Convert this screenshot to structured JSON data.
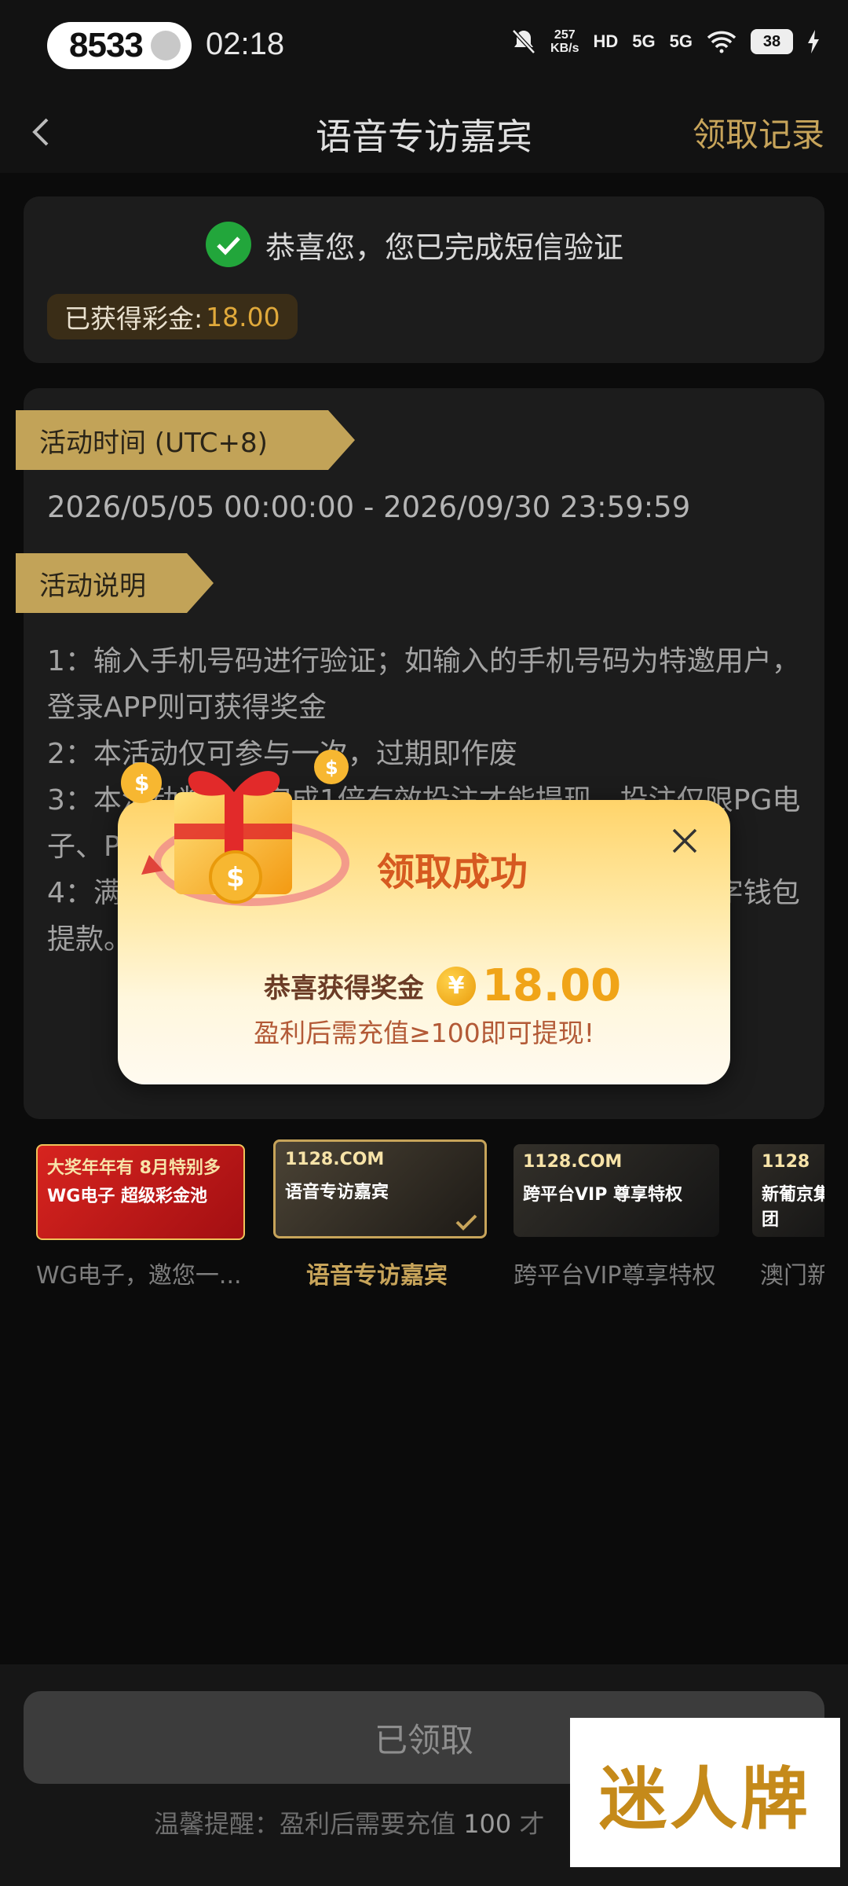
{
  "status_bar": {
    "pill_number": "8533",
    "time": "02:18",
    "net_speed": "257",
    "net_unit": "KB/s",
    "hd_label": "HD",
    "signal1": "5G",
    "signal2": "5G",
    "battery": "38"
  },
  "header": {
    "title": "语音专访嘉宾",
    "records_link": "领取记录"
  },
  "verification": {
    "message": "恭喜您，您已完成短信验证",
    "bonus_label": "已获得彩金:",
    "bonus_amount": "18.00"
  },
  "activity": {
    "time_tag": "活动时间 (UTC+8)",
    "time_range": "2026/05/05 00:00:00 - 2026/09/30 23:59:59",
    "desc_tag": "活动说明",
    "rules": [
      "1：输入手机号码进行验证；如输入的手机号码为特邀用户，登录APP则可获得奖金",
      "2：本活动仅可参与一次，过期即作废",
      "3：本活动奖金需完成1倍有效投注才能提现，投注仅限PG电子、PG电子",
      "4：满足以上条件后，提款额度达到要求，建议使用数字钱包提款。"
    ]
  },
  "banners": [
    {
      "title": "大奖年年有 8月特别多",
      "sub": "WG电子 超级彩金池",
      "label": "WG电子，邀您一..."
    },
    {
      "title": "1128.COM",
      "sub": "语音专访嘉宾",
      "label": "语音专访嘉宾"
    },
    {
      "title": "1128.COM",
      "sub": "跨平台VIP 尊享特权",
      "label": "跨平台VIP尊享特权"
    },
    {
      "title": "1128",
      "sub": "新葡京集团",
      "label": "澳门新"
    }
  ],
  "bottom": {
    "claimed_button": "已领取",
    "reminder_prefix": "温馨提醒：盈利后需要充值",
    "reminder_amount": "100",
    "reminder_suffix": "才"
  },
  "watermark": "迷人牌",
  "popup": {
    "title": "领取成功",
    "prize_label": "恭喜获得奖金",
    "coin_symbol": "¥",
    "prize_amount": "18.00",
    "hint": "盈利后需充值≥100即可提现!"
  },
  "colors": {
    "accent_gold": "#c7a45a",
    "bonus_amount": "#e0a93b",
    "popup_title": "#d65a20",
    "success_green": "#22a63b"
  }
}
